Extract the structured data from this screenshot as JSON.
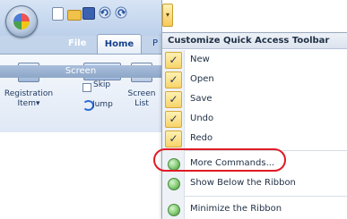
{
  "app": {
    "tabs": {
      "file": "File",
      "home": "Home",
      "cut": "P"
    },
    "group_label": "Screen",
    "registration_label_1": "Registration",
    "registration_label_2": "Item",
    "registration_dropdown": "▾",
    "skip_label": "Skip",
    "jump_label": "Jump",
    "screen_list_label_1": "Screen",
    "screen_list_label_2": "List",
    "qat_more_glyph": "▾"
  },
  "menu": {
    "title": "Customize Quick Access Toolbar",
    "items": [
      {
        "label": "New",
        "checked": true,
        "check_glyph": "✓"
      },
      {
        "label": "Open",
        "checked": true,
        "check_glyph": "✓"
      },
      {
        "label": "Save",
        "checked": true,
        "check_glyph": "✓"
      },
      {
        "label": "Undo",
        "checked": true,
        "check_glyph": "✓"
      },
      {
        "label": "Redo",
        "checked": true,
        "check_glyph": "✓"
      }
    ],
    "more_commands": "More Commands...",
    "show_below": "Show Below the Ribbon",
    "minimize": "Minimize the Ribbon"
  },
  "colors": {
    "highlight_ring": "#e01b24"
  }
}
